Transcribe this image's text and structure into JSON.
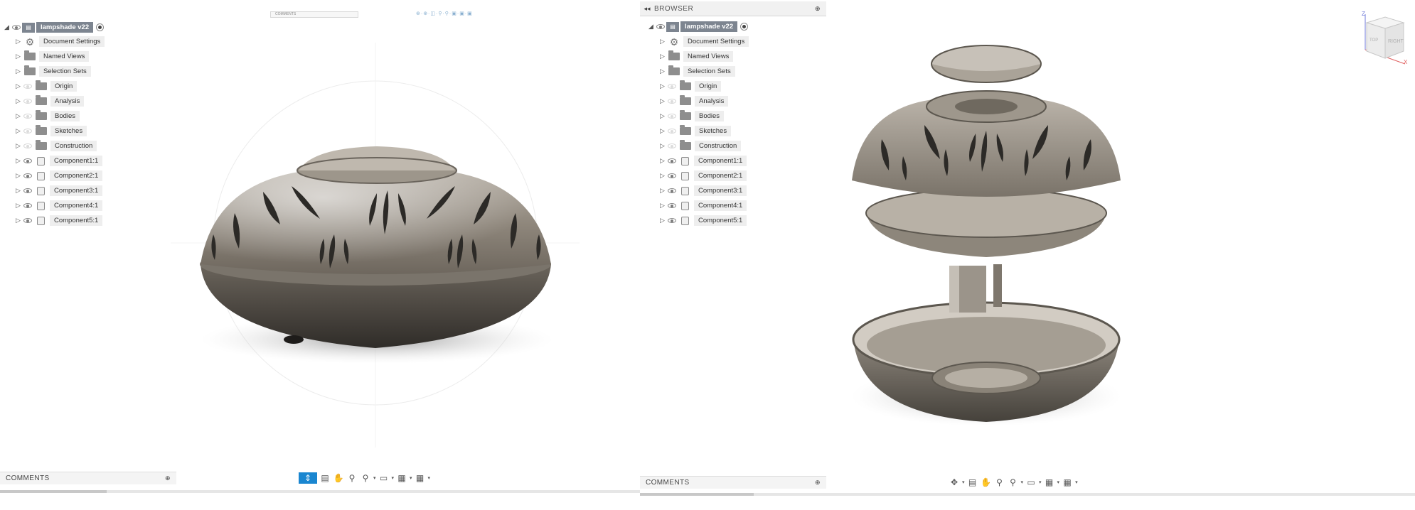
{
  "browser_left": {
    "root": {
      "label": "lampshade v22"
    },
    "items": [
      {
        "label": "Document Settings",
        "icon": "gear-icon"
      },
      {
        "label": "Named Views",
        "icon": "folder-icon"
      },
      {
        "label": "Selection Sets",
        "icon": "folder-icon"
      },
      {
        "label": "Origin",
        "icon": "folder-icon"
      },
      {
        "label": "Analysis",
        "icon": "folder-icon"
      },
      {
        "label": "Bodies",
        "icon": "folder-icon"
      },
      {
        "label": "Sketches",
        "icon": "folder-icon"
      },
      {
        "label": "Construction",
        "icon": "folder-icon"
      },
      {
        "label": "Component1:1",
        "icon": "component-icon"
      },
      {
        "label": "Component2:1",
        "icon": "component-icon"
      },
      {
        "label": "Component3:1",
        "icon": "component-icon"
      },
      {
        "label": "Component4:1",
        "icon": "component-icon"
      },
      {
        "label": "Component5:1",
        "icon": "component-icon"
      }
    ]
  },
  "browser_right": {
    "header": "BROWSER",
    "root": {
      "label": "lampshade v22"
    },
    "items": [
      {
        "label": "Document Settings",
        "icon": "gear-icon"
      },
      {
        "label": "Named Views",
        "icon": "folder-icon"
      },
      {
        "label": "Selection Sets",
        "icon": "folder-icon"
      },
      {
        "label": "Origin",
        "icon": "folder-icon"
      },
      {
        "label": "Analysis",
        "icon": "folder-icon"
      },
      {
        "label": "Bodies",
        "icon": "folder-icon"
      },
      {
        "label": "Sketches",
        "icon": "folder-icon"
      },
      {
        "label": "Construction",
        "icon": "folder-icon"
      },
      {
        "label": "Component1:1",
        "icon": "component-icon"
      },
      {
        "label": "Component2:1",
        "icon": "component-icon"
      },
      {
        "label": "Component3:1",
        "icon": "component-icon"
      },
      {
        "label": "Component4:1",
        "icon": "component-icon"
      },
      {
        "label": "Component5:1",
        "icon": "component-icon"
      }
    ]
  },
  "comments_left": {
    "label": "COMMENTS"
  },
  "comments_right": {
    "label": "COMMENTS"
  },
  "top_search": {
    "placeholder": "COMMENTS"
  },
  "viewcube": {
    "right_label": "RIGHT",
    "top_label": "TOP",
    "axis_z": "Z",
    "axis_x": "X"
  },
  "colors": {
    "accent": "#1a86d0",
    "root_label_bg": "#7d8590",
    "model_metal": "#8a8278",
    "model_dark": "#4a4640"
  }
}
